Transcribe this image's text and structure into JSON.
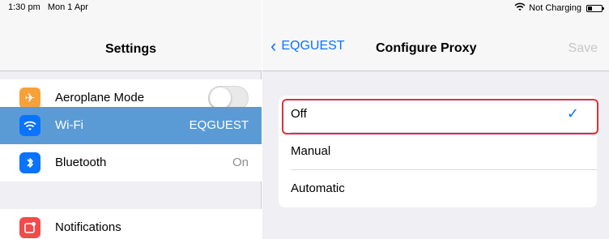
{
  "status": {
    "time": "1:30 pm",
    "date": "Mon 1 Apr",
    "charging": "Not Charging",
    "wifi_icon": "wifi-icon",
    "battery_icon": "battery-icon"
  },
  "left": {
    "title": "Settings",
    "rows": [
      {
        "label": "Aeroplane Mode",
        "icon": "airplane-icon",
        "color": "#f6a13a",
        "value": ""
      },
      {
        "label": "Wi-Fi",
        "icon": "wifi-icon",
        "color": "#0a73ff",
        "value": "EQGUEST"
      },
      {
        "label": "Bluetooth",
        "icon": "bluetooth-icon",
        "color": "#0a73ff",
        "value": "On"
      },
      {
        "label": "Notifications",
        "icon": "notifications-icon",
        "color": "#f34b4b",
        "value": ""
      }
    ]
  },
  "right": {
    "back_label": "EQGUEST",
    "title": "Configure Proxy",
    "save_label": "Save",
    "options": [
      {
        "label": "Off",
        "selected": true
      },
      {
        "label": "Manual",
        "selected": false
      },
      {
        "label": "Automatic",
        "selected": false
      }
    ]
  }
}
